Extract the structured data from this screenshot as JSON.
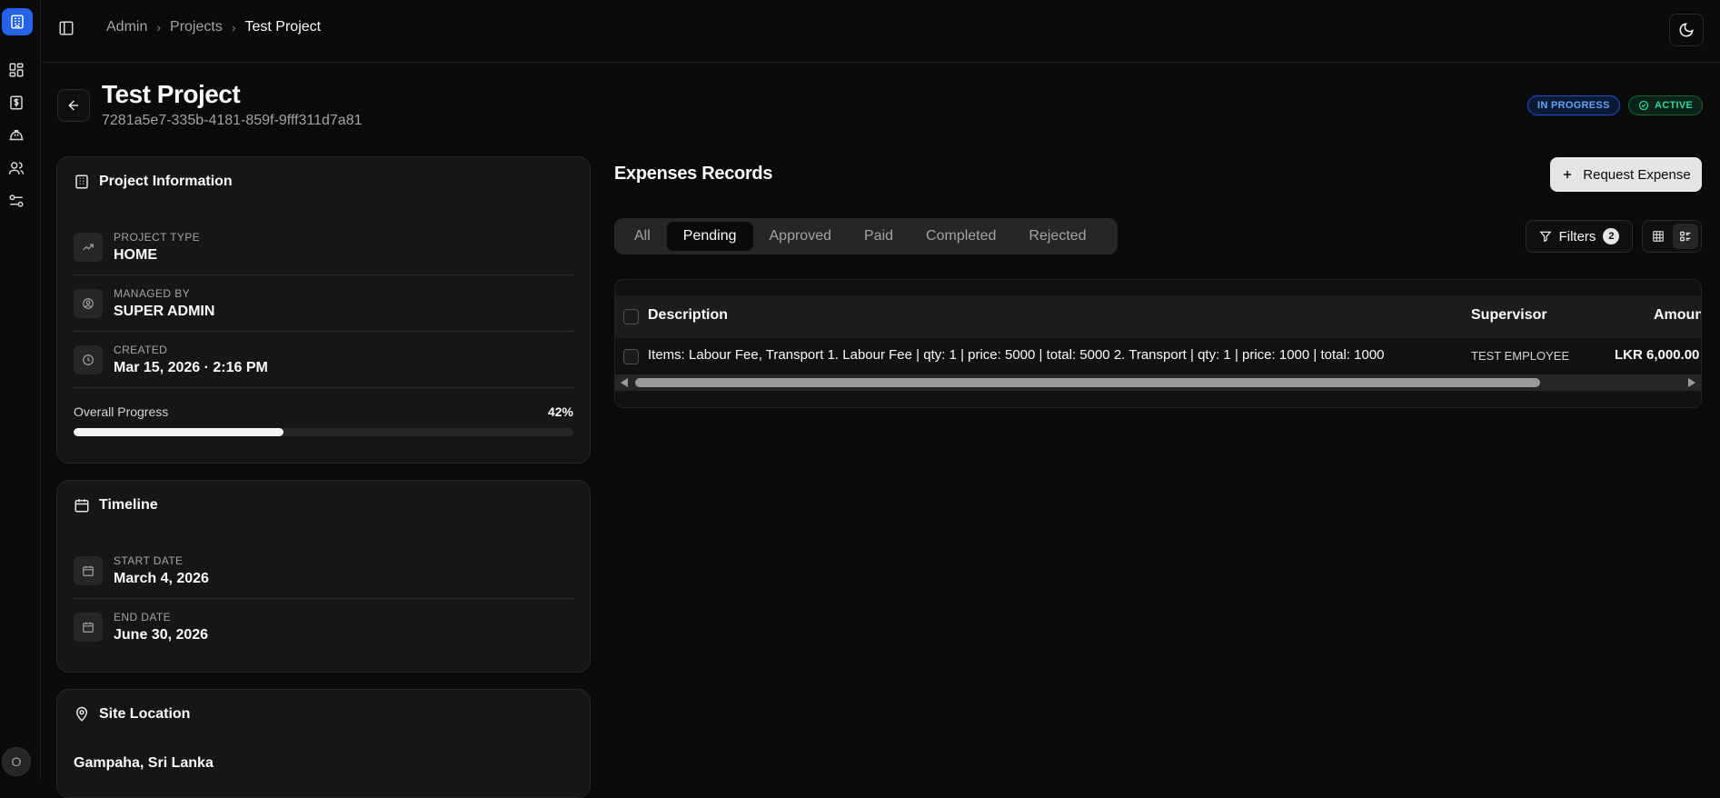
{
  "breadcrumb": [
    "Admin",
    "Projects",
    "Test Project"
  ],
  "project": {
    "title": "Test Project",
    "id": "7281a5e7-335b-4181-859f-9fff311d7a81",
    "status_badge": "IN PROGRESS",
    "active_badge": "ACTIVE"
  },
  "info_card": {
    "title": "Project Information",
    "type_label": "PROJECT TYPE",
    "type_value": "HOME",
    "managed_label": "MANAGED BY",
    "managed_value": "SUPER ADMIN",
    "created_label": "CREATED",
    "created_value": "Mar 15, 2026 · 2:16 PM",
    "progress_label": "Overall Progress",
    "progress_text": "42%",
    "progress_value": 42
  },
  "timeline_card": {
    "title": "Timeline",
    "start_label": "START DATE",
    "start_value": "March 4, 2026",
    "end_label": "END DATE",
    "end_value": "June 30, 2026"
  },
  "location_card": {
    "title": "Site Location",
    "value": "Gampaha, Sri Lanka"
  },
  "expenses": {
    "title": "Expenses Records",
    "request_label": "Request Expense",
    "tabs": [
      "All",
      "Pending",
      "Approved",
      "Paid",
      "Completed",
      "Rejected"
    ],
    "active_tab": "Pending",
    "filters_label": "Filters",
    "filters_count": "2",
    "columns": [
      "Description",
      "Supervisor",
      "Amount"
    ],
    "rows": [
      {
        "description": "Items: Labour Fee, Transport 1. Labour Fee | qty: 1 | price: 5000 | total: 5000 2. Transport | qty: 1 | price: 1000 | total: 1000",
        "supervisor": "TEST EMPLOYEE",
        "amount": "LKR 6,000.00"
      }
    ]
  },
  "user": {
    "initial": "O"
  },
  "colors": {
    "accent": "#2563eb",
    "in_progress": "#60a5fa",
    "active": "#34d399"
  }
}
